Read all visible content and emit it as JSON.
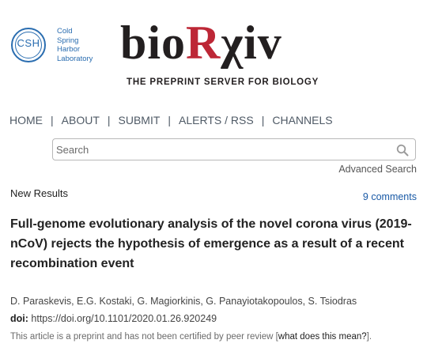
{
  "logo": {
    "csh_letters": "CSH",
    "csh_lines": [
      "Cold",
      "Spring",
      "Harbor",
      "Laboratory"
    ],
    "site_name_prefix": "bio",
    "site_name_r": "R",
    "site_name_suffix": "χiv",
    "tagline": "THE PREPRINT SERVER FOR BIOLOGY"
  },
  "nav": {
    "items": [
      "HOME",
      "ABOUT",
      "SUBMIT",
      "ALERTS / RSS",
      "CHANNELS"
    ],
    "separator": "|"
  },
  "search": {
    "placeholder": "Search",
    "advanced_label": "Advanced Search"
  },
  "article": {
    "section_label": "New Results",
    "comments_label": "9 comments",
    "title": "Full-genome evolutionary analysis of the novel corona virus (2019-nCoV) rejects the hypothesis of emergence as a result of a recent recombination event",
    "authors": "D. Paraskevis, E.G. Kostaki, G. Magiorkinis, G. Panayiotakopoulos, S. Tsiodras",
    "doi_label": "doi:",
    "doi_value": "https://doi.org/10.1101/2020.01.26.920249",
    "notice_text": "This article is a preprint and has not been certified by peer review [",
    "notice_link": "what does this mean?",
    "notice_end": "]."
  },
  "colors": {
    "brand_blue": "#2a6db0",
    "brand_red": "#bd2736",
    "link_blue": "#1a5aa6"
  }
}
